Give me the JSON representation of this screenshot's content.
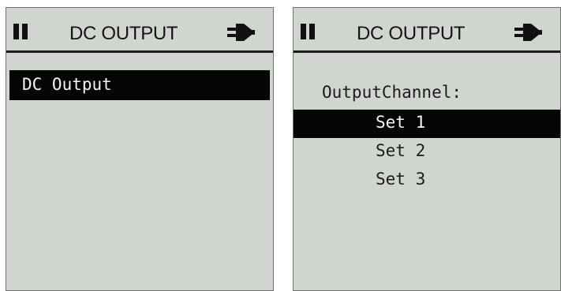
{
  "left_screen": {
    "header": {
      "title": "DC OUTPUT",
      "left_icon": "pause-icon",
      "right_icon": "plug-icon"
    },
    "menu": {
      "items": [
        {
          "label": "DC Output",
          "selected": true
        }
      ]
    }
  },
  "right_screen": {
    "header": {
      "title": "DC OUTPUT",
      "left_icon": "pause-icon",
      "right_icon": "plug-icon"
    },
    "channel_label": "OutputChannel:",
    "options": [
      {
        "label": "Set 1",
        "selected": true
      },
      {
        "label": "Set 2",
        "selected": false
      },
      {
        "label": "Set 3",
        "selected": false
      }
    ]
  },
  "colors": {
    "screen_background": "#d1d5cf",
    "highlight": "#050505",
    "highlight_text": "#f4f4f4",
    "text": "#1b1b1b"
  }
}
